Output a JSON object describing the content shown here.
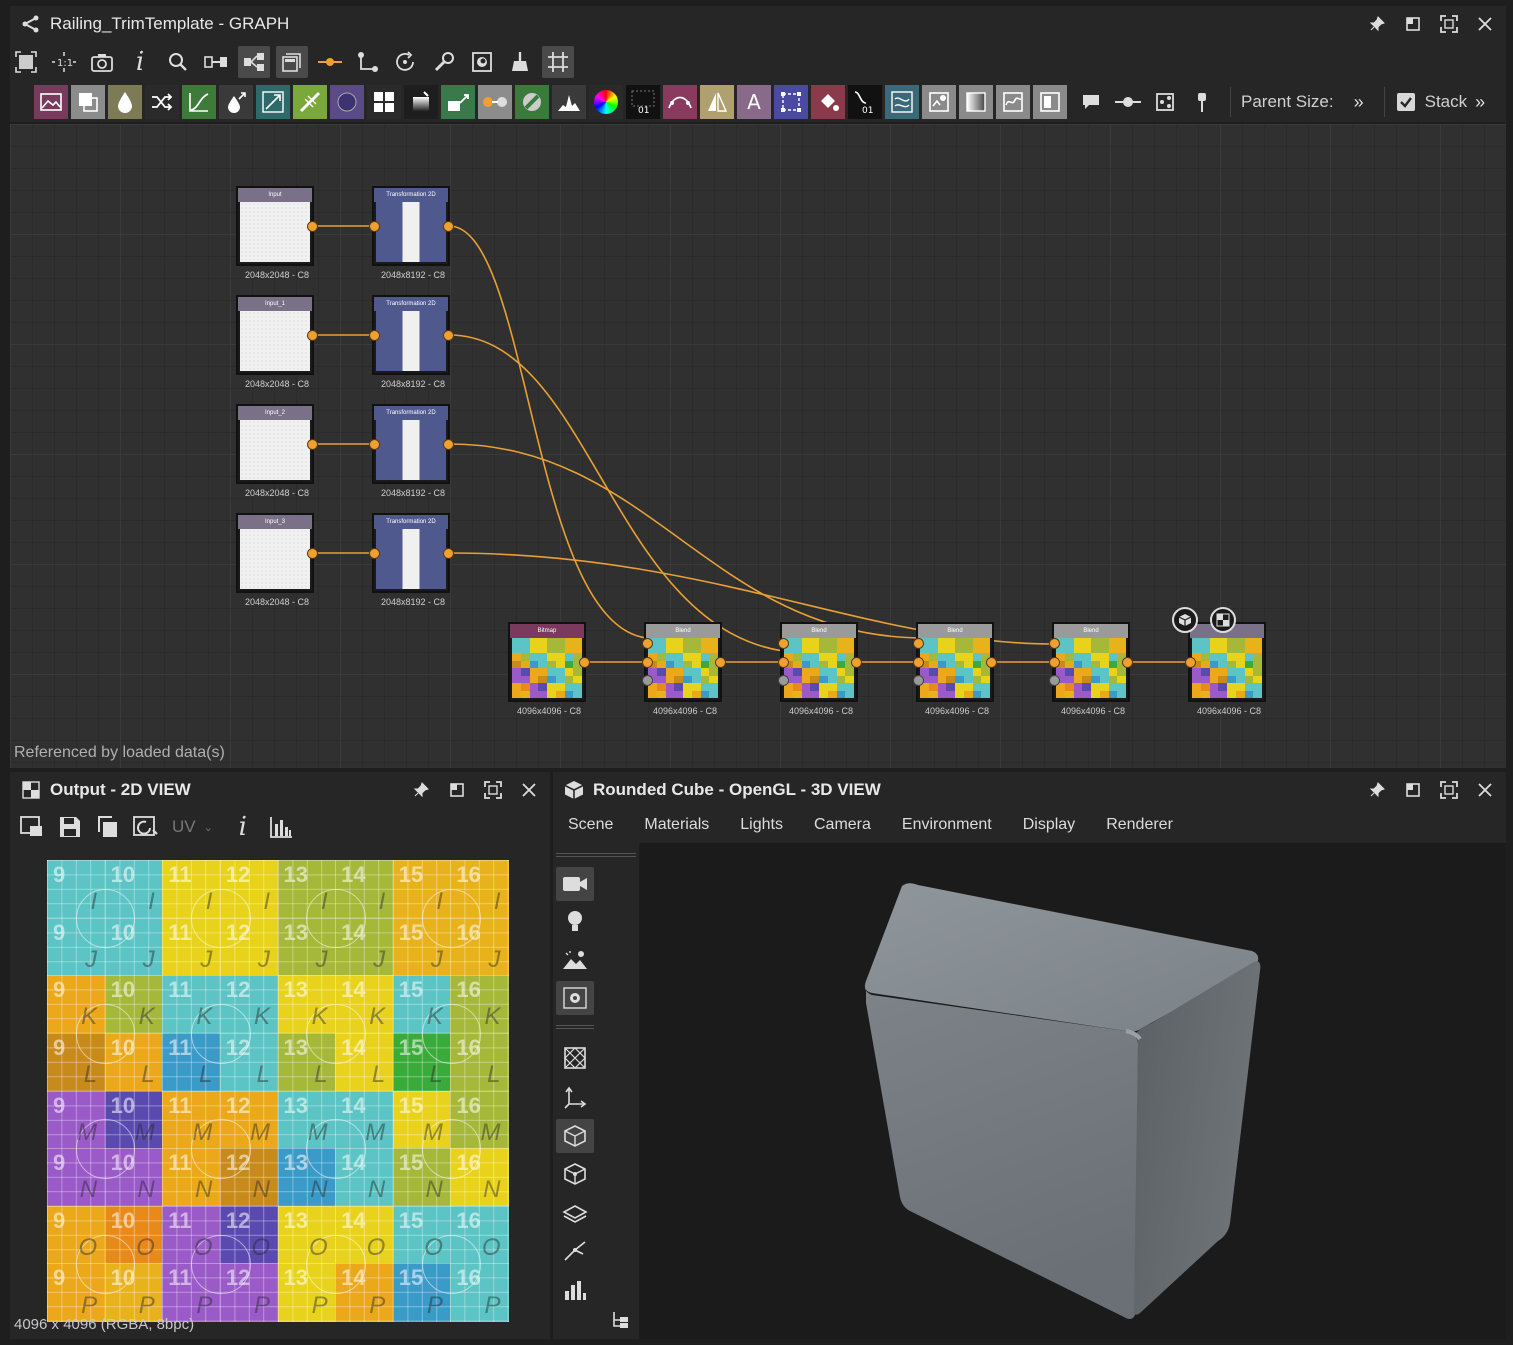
{
  "graph": {
    "title": "Railing_TrimTemplate - GRAPH",
    "parent_size_label": "Parent Size:",
    "stack_label": "Stack",
    "referenced_text": "Referenced by loaded data(s)",
    "nodes": {
      "input": {
        "title": "Input",
        "res": "2048x2048 - C8"
      },
      "input1": {
        "title": "Input_1",
        "res": "2048x2048 - C8"
      },
      "input2": {
        "title": "Input_2",
        "res": "2048x2048 - C8"
      },
      "input3": {
        "title": "Input_3",
        "res": "2048x2048 - C8"
      },
      "trans0": {
        "title": "Transformation 2D",
        "res": "2048x8192 - C8"
      },
      "trans1": {
        "title": "Transformation 2D",
        "res": "2048x8192 - C8"
      },
      "trans2": {
        "title": "Transformation 2D",
        "res": "2048x8192 - C8"
      },
      "trans3": {
        "title": "Transformation 2D",
        "res": "2048x8192 - C8"
      },
      "bitmap": {
        "title": "Bitmap",
        "res": "4096x4096 - C8"
      },
      "blend1": {
        "title": "Blend",
        "res": "4096x4096 - C8"
      },
      "blend2": {
        "title": "Blend",
        "res": "4096x4096 - C8"
      },
      "blend3": {
        "title": "Blend",
        "res": "4096x4096 - C8"
      },
      "blend4": {
        "title": "Blend",
        "res": "4096x4096 - C8"
      },
      "output": {
        "res": "4096x4096 - C8"
      }
    }
  },
  "view2d": {
    "title": "Output - 2D VIEW",
    "uv_label": "UV",
    "info": "4096 x 4096 (RGBA, 8bpc)"
  },
  "view3d": {
    "title": "Rounded Cube - OpenGL - 3D VIEW",
    "menu": [
      "Scene",
      "Materials",
      "Lights",
      "Camera",
      "Environment",
      "Display",
      "Renderer"
    ]
  },
  "texture": {
    "col_numbers": [
      "9",
      "10",
      "11",
      "12",
      "13",
      "14",
      "15",
      "16"
    ],
    "row_letters": [
      "I",
      "J",
      "K",
      "L",
      "M",
      "N",
      "O",
      "P"
    ]
  },
  "colors": {
    "panel": "#262626",
    "accent_orange": "#f0a030",
    "node_blue": "#50598e"
  }
}
